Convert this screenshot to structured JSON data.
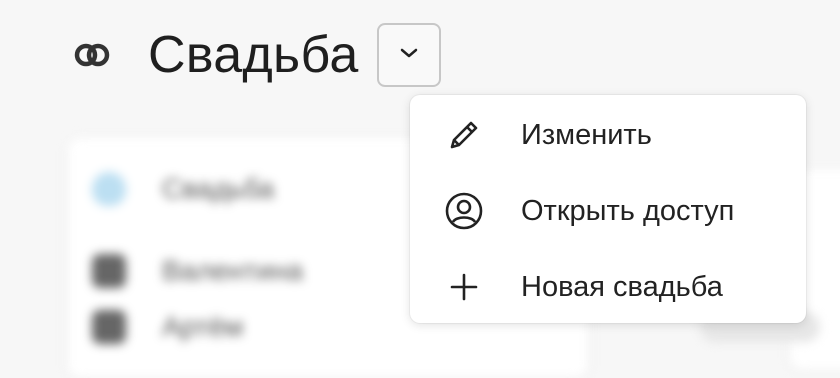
{
  "header": {
    "logo_icon": "wedding-rings-icon",
    "title": "Свадьба",
    "dropdown_icon": "chevron-down-icon"
  },
  "menu": {
    "items": [
      {
        "label": "Изменить",
        "icon": "pencil-icon"
      },
      {
        "label": "Открыть доступ",
        "icon": "user-circle-icon"
      },
      {
        "label": "Новая свадьба",
        "icon": "plus-icon"
      }
    ]
  },
  "background": {
    "sidebar_items": [
      {
        "label": "Свадьба",
        "icon": "shield-icon"
      },
      {
        "label": "Валентина",
        "icon": "person-icon"
      },
      {
        "label": "Артём",
        "icon": "person-icon"
      }
    ]
  },
  "colors": {
    "text": "#222222",
    "border": "#c7c7c7",
    "background": "#f7f7f7",
    "menu_background": "#ffffff"
  }
}
